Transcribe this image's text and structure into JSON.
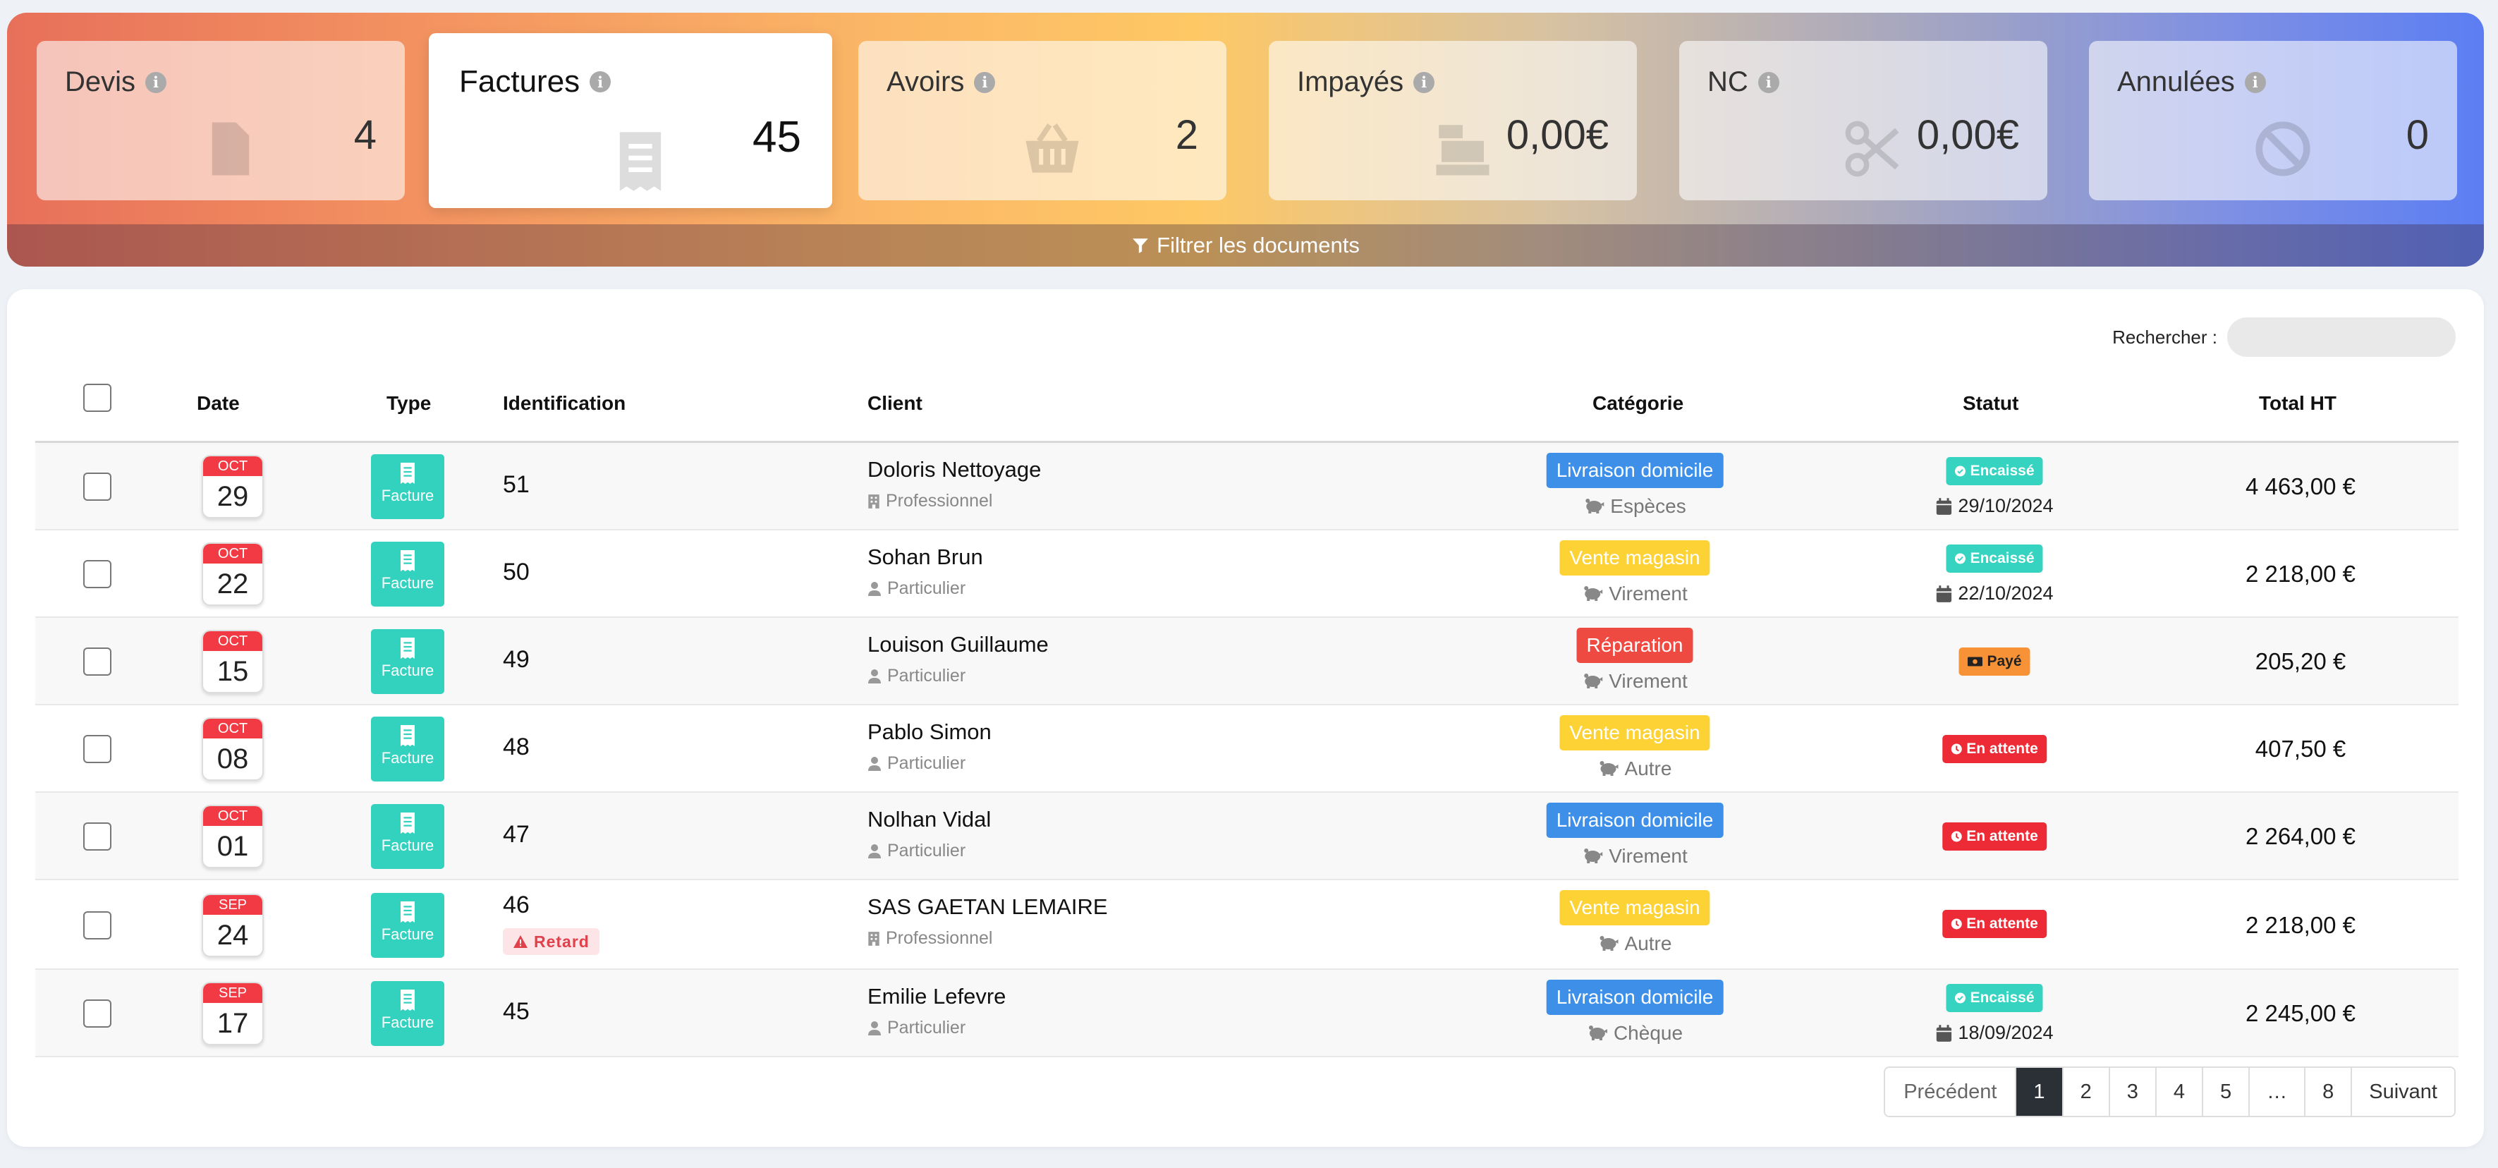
{
  "summary": {
    "cards": [
      {
        "label": "Devis",
        "value": "4",
        "icon": "file-icon"
      },
      {
        "label": "Factures",
        "value": "45",
        "icon": "receipt-icon"
      },
      {
        "label": "Avoirs",
        "value": "2",
        "icon": "basket-icon"
      },
      {
        "label": "Impayés",
        "value": "0,00€",
        "icon": "cash-register-icon"
      },
      {
        "label": "NC",
        "value": "0,00€",
        "icon": "scissors-icon"
      },
      {
        "label": "Annulées",
        "value": "0",
        "icon": "ban-icon"
      }
    ],
    "filter_label": "Filtrer les documents"
  },
  "search": {
    "label": "Rechercher :",
    "value": ""
  },
  "table": {
    "headers": {
      "date": "Date",
      "type": "Type",
      "identification": "Identification",
      "client": "Client",
      "category": "Catégorie",
      "status": "Statut",
      "total": "Total HT"
    },
    "rows": [
      {
        "month": "OCT",
        "day": "29",
        "type": "Facture",
        "id": "51",
        "client": "Doloris Nettoyage",
        "client_kind": "Professionnel",
        "category": "Livraison domicile",
        "payment": "Espèces",
        "status": "Encaissé",
        "status_date": "29/10/2024",
        "total": "4 463,00 €"
      },
      {
        "month": "OCT",
        "day": "22",
        "type": "Facture",
        "id": "50",
        "client": "Sohan Brun",
        "client_kind": "Particulier",
        "category": "Vente magasin",
        "payment": "Virement",
        "status": "Encaissé",
        "status_date": "22/10/2024",
        "total": "2 218,00 €"
      },
      {
        "month": "OCT",
        "day": "15",
        "type": "Facture",
        "id": "49",
        "client": "Louison Guillaume",
        "client_kind": "Particulier",
        "category": "Réparation",
        "payment": "Virement",
        "status": "Payé",
        "status_date": "",
        "total": "205,20 €"
      },
      {
        "month": "OCT",
        "day": "08",
        "type": "Facture",
        "id": "48",
        "client": "Pablo Simon",
        "client_kind": "Particulier",
        "category": "Vente magasin",
        "payment": "Autre",
        "status": "En attente",
        "status_date": "",
        "total": "407,50 €"
      },
      {
        "month": "OCT",
        "day": "01",
        "type": "Facture",
        "id": "47",
        "client": "Nolhan Vidal",
        "client_kind": "Particulier",
        "category": "Livraison domicile",
        "payment": "Virement",
        "status": "En attente",
        "status_date": "",
        "total": "2 264,00 €"
      },
      {
        "month": "SEP",
        "day": "24",
        "type": "Facture",
        "id": "46",
        "flag": "Retard",
        "client": "SAS GAETAN LEMAIRE",
        "client_kind": "Professionnel",
        "category": "Vente magasin",
        "payment": "Autre",
        "status": "En attente",
        "status_date": "",
        "total": "2 218,00 €"
      },
      {
        "month": "SEP",
        "day": "17",
        "type": "Facture",
        "id": "45",
        "client": "Emilie Lefevre",
        "client_kind": "Particulier",
        "category": "Livraison domicile",
        "payment": "Chèque",
        "status": "Encaissé",
        "status_date": "18/09/2024",
        "total": "2 245,00 €"
      }
    ]
  },
  "pagination": {
    "prev": "Précédent",
    "pages": [
      "1",
      "2",
      "3",
      "4",
      "5",
      "…",
      "8"
    ],
    "active": "1",
    "next": "Suivant"
  },
  "colors": {
    "category": {
      "Livraison domicile": "#3d8fe8",
      "Vente magasin": "#fdd234",
      "Réparation": "#ee4a42"
    },
    "status": {
      "Encaissé": "#35d3c0",
      "Payé": "#f79336",
      "En attente": "#ec2b36"
    },
    "type_badge": "#32d2bf",
    "calendar_month": "#f23a44"
  }
}
